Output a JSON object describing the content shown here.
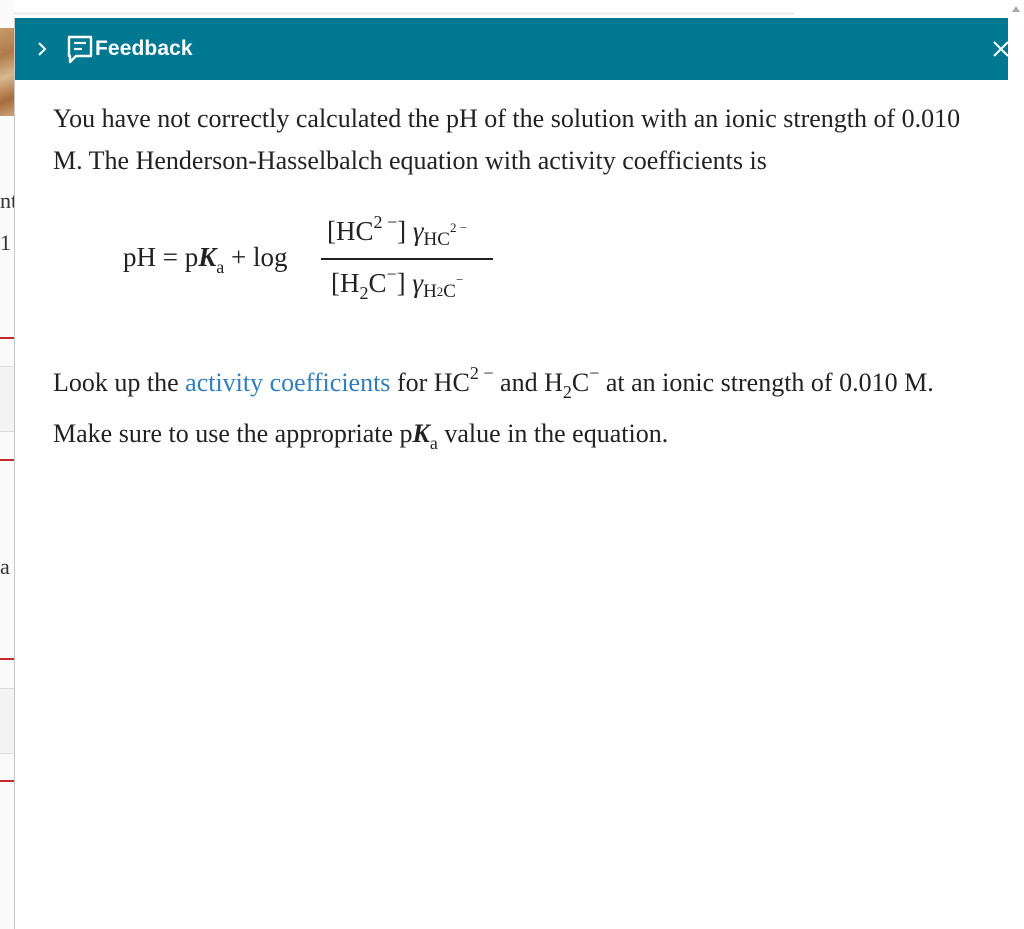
{
  "background": {
    "fragments": [
      "nt",
      "1 :",
      "a"
    ]
  },
  "panel": {
    "title": "Feedback",
    "paragraph1": "You have not correctly calculated the pH of the solution with an ionic strength of 0.010 M. The Henderson-Hasselbalch equation with activity coefficients is",
    "equation": {
      "lhs_ph": "pH",
      "equals": "=",
      "p": "p",
      "K": "K",
      "a_sub": "a",
      "plus_log": "+ log",
      "num_species": "[HC",
      "num_charge": "2 −",
      "num_close": "]",
      "gamma": "γ",
      "num_gamma_sub": "HC",
      "num_gamma_sup": "2 −",
      "den_open": "[H",
      "den_sub": "2",
      "den_species": "C",
      "den_charge": "−",
      "den_close": "]",
      "den_gamma_sub": "H",
      "den_gamma_sub2": "2",
      "den_gamma_c": "C",
      "den_gamma_sup": "−"
    },
    "paragraph2": {
      "before": "Look up the",
      "link": "activity coefficients",
      "after_link": "for HC",
      "hc_charge": "2 −",
      "and": "and H",
      "h_sub": "2",
      "c": "C",
      "c_charge": "−",
      "rest": "at an ionic strength of 0.010 M. Make sure to use the appropriate p",
      "K": "K",
      "a_sub": "a",
      "end": "value in the equation."
    }
  },
  "colors": {
    "header_bg": "#007891",
    "link": "#2f7ec1",
    "background_accent_line": "#c62828"
  },
  "icons": {
    "collapse": "chevron-right-icon",
    "feedback": "feedback-comment-icon",
    "close": "close-icon"
  }
}
